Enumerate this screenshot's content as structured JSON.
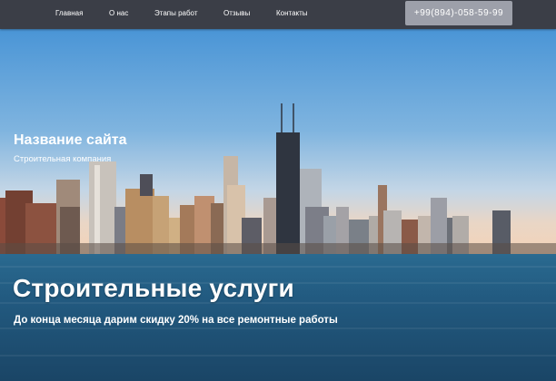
{
  "nav": {
    "items": [
      {
        "label": "Главная"
      },
      {
        "label": "О нас"
      },
      {
        "label": "Этапы работ"
      },
      {
        "label": "Отзывы"
      },
      {
        "label": "Контакты"
      }
    ],
    "phone": "+99(894)-058-59-99"
  },
  "hero": {
    "site_title": "Название сайта",
    "site_subtitle": "Строительная компания",
    "heading": "Строительные услуги",
    "promo": "До конца месяца дарим скидку 20% на все ремонтные работы",
    "colors": {
      "sky_top": "#4a95d6",
      "sky_horizon": "#f4d3b7",
      "water": "#1d4a6e",
      "nav_bg": "#3b3e47",
      "phone_bg": "#9da0aa"
    }
  }
}
